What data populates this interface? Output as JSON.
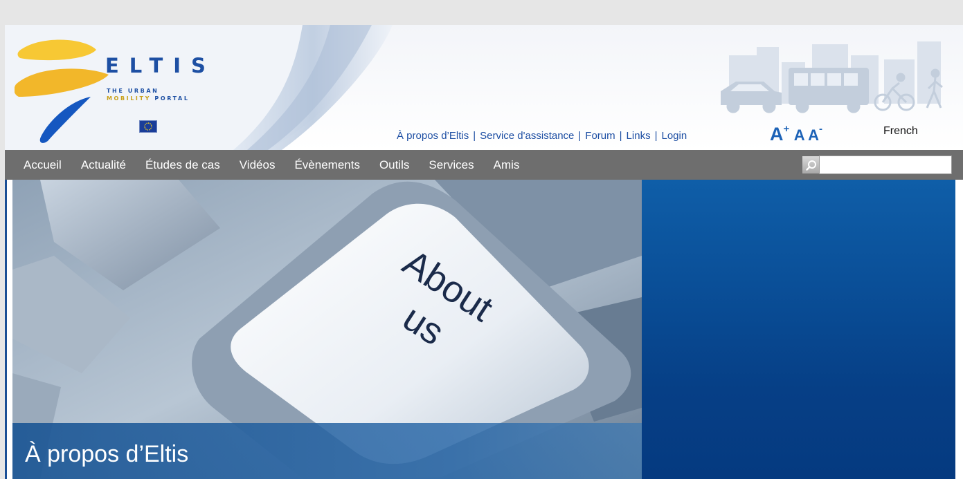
{
  "logo": {
    "wordmark": "ELTIS",
    "tagline_line1": "THE URBAN",
    "tagline_line2_part1": "MOBILITY",
    "tagline_line2_part2": "PORTAL"
  },
  "toplinks": [
    {
      "label": "À propos d’Eltis"
    },
    {
      "label": "Service d'assistance"
    },
    {
      "label": "Forum"
    },
    {
      "label": "Links"
    },
    {
      "label": "Login"
    }
  ],
  "font_size": {
    "increase": "A",
    "normal": "A",
    "decrease": "A",
    "plus": "+",
    "minus": "-"
  },
  "language": {
    "selected": "French"
  },
  "nav": {
    "items": [
      {
        "label": "Accueil"
      },
      {
        "label": "Actualité"
      },
      {
        "label": "Études de cas"
      },
      {
        "label": "Vidéos"
      },
      {
        "label": "Évènements"
      },
      {
        "label": "Outils"
      },
      {
        "label": "Services"
      },
      {
        "label": "Amis"
      }
    ]
  },
  "search": {
    "value": "",
    "placeholder": "",
    "icon": "magnifier-icon"
  },
  "hero": {
    "key_text_line1": "About",
    "key_text_line2": "us",
    "title": "À propos d’Eltis"
  },
  "colors": {
    "brand_blue": "#1d4fa3",
    "nav_bg": "#6e6e6e",
    "panel_blue": "#0a4f98",
    "logo_yellow": "#f7c834"
  }
}
